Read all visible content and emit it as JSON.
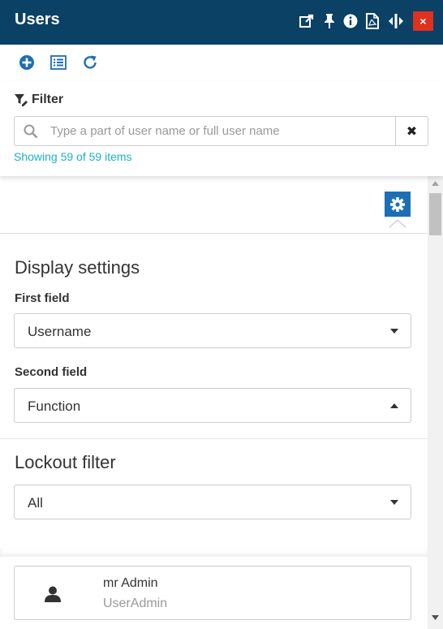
{
  "window": {
    "title": "Users",
    "icons": [
      "edit-external-icon",
      "pin-icon",
      "info-icon",
      "pdf-icon",
      "resize-horizontal-icon",
      "close-icon"
    ],
    "close_label": "×"
  },
  "toolbar": {
    "icons": [
      "add-circle-icon",
      "list-view-icon",
      "refresh-icon"
    ]
  },
  "filter": {
    "label": "Filter",
    "placeholder": "Type a part of user name or full user name",
    "value": "",
    "clear_label": "✖",
    "count_text": "Showing 59 of 59 items"
  },
  "display_settings": {
    "heading": "Display settings",
    "first_field_label": "First field",
    "first_field_value": "Username",
    "second_field_label": "Second field",
    "second_field_value": "Function"
  },
  "lockout": {
    "heading": "Lockout filter",
    "value": "All"
  },
  "users": [
    {
      "name": "mr Admin",
      "function": "UserAdmin"
    }
  ],
  "colors": {
    "titlebar": "#0a4165",
    "accent": "#1c6fb5",
    "close": "#e0301e",
    "count_text": "#1ab0c6"
  }
}
